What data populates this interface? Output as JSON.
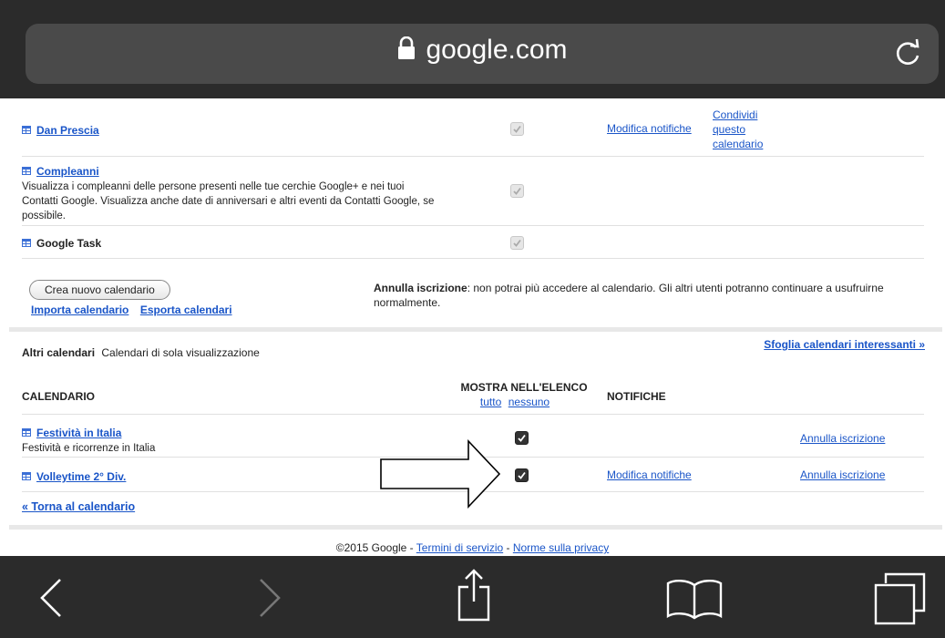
{
  "browser": {
    "url": "google.com"
  },
  "my_calendars": [
    {
      "name": "Dan Prescia",
      "description": "",
      "shown": true,
      "notification_link": "Modifica notifiche",
      "share_link": [
        "Condividi",
        "questo",
        "calendario"
      ]
    },
    {
      "name": "Compleanni",
      "description": "Visualizza i compleanni delle persone presenti nelle tue cerchie Google+ e nei tuoi Contatti Google. Visualizza anche date di anniversari e altri eventi da Contatti Google, se possibile.",
      "shown": true
    },
    {
      "name": "Google Task",
      "description": "",
      "shown": true
    }
  ],
  "actions": {
    "new_calendar_button": "Crea nuovo calendario",
    "import_link": "Importa calendario",
    "export_link": "Esporta calendari",
    "unsubscribe_label": "Annulla iscrizione",
    "unsubscribe_note": ": non potrai più accedere al calendario. Gli altri utenti potranno continuare a usufruirne normalmente."
  },
  "other_calendars": {
    "title": "Altri calendari",
    "subtitle": "Calendari di sola visualizzazione",
    "browse_link": "Sfoglia calendari interessanti »",
    "headers": {
      "calendar": "CALENDARIO",
      "show_in_list": "MOSTRA NELL'ELENCO",
      "all": "tutto",
      "none": "nessuno",
      "notifications": "NOTIFICHE"
    },
    "items": [
      {
        "name": "Festività in Italia",
        "description": "Festività e ricorrenze in Italia",
        "shown": true,
        "notification_link": "",
        "unsubscribe_link": "Annulla iscrizione"
      },
      {
        "name": "Volleytime 2° Div.",
        "description": "",
        "shown": true,
        "notification_link": "Modifica notifiche",
        "unsubscribe_link": "Annulla iscrizione"
      }
    ]
  },
  "back_link": "« Torna al calendario",
  "footer": {
    "copyright": "©2015 Google - ",
    "terms": "Termini di servizio",
    "dash": " - ",
    "privacy": "Norme sulla privacy"
  },
  "icons": {
    "lock": "lock-icon",
    "reload": "reload-icon",
    "back": "chevron-left-icon",
    "forward": "chevron-right-icon",
    "share": "share-icon",
    "bookmarks": "book-icon",
    "tabs": "tabs-icon",
    "arrow": "arrow-annotation"
  },
  "colors": {
    "link": "#1a55c8",
    "chrome": "#2b2b2b"
  }
}
